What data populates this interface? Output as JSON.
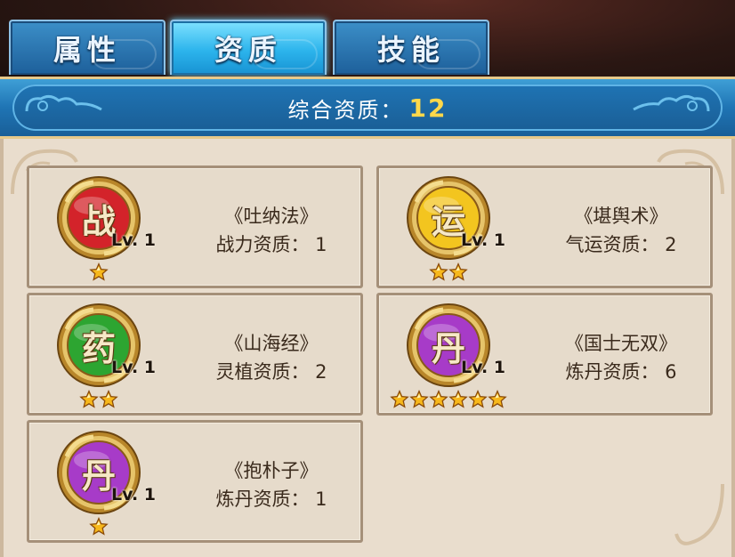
{
  "tabs": [
    {
      "label": "属性",
      "active": false
    },
    {
      "label": "资质",
      "active": true
    },
    {
      "label": "技能",
      "active": false
    }
  ],
  "header": {
    "label": "综合资质：",
    "value": "12"
  },
  "cards": [
    {
      "medal_char": "战",
      "medal_color": "#d3232a",
      "level": "Lv. 1",
      "stars": 1,
      "book": "《吐纳法》",
      "stat": "战力资质： 1"
    },
    {
      "medal_char": "运",
      "medal_color": "#f3c51f",
      "level": "Lv. 1",
      "stars": 2,
      "book": "《堪舆术》",
      "stat": "气运资质： 2"
    },
    {
      "medal_char": "药",
      "medal_color": "#2da531",
      "level": "Lv. 1",
      "stars": 2,
      "book": "《山海经》",
      "stat": "灵植资质： 2"
    },
    {
      "medal_char": "丹",
      "medal_color": "#a73bc8",
      "level": "Lv. 1",
      "stars": 6,
      "book": "《国士无双》",
      "stat": "炼丹资质： 6"
    },
    {
      "medal_char": "丹",
      "medal_color": "#a73bc8",
      "level": "Lv. 1",
      "stars": 1,
      "book": "《抱朴子》",
      "stat": "炼丹资质： 1"
    }
  ],
  "colors": {
    "tab_active": "#2cb4ec",
    "tab_inactive": "#1d5f9a",
    "value_gold": "#ffd84a",
    "star": "#f7b81b"
  },
  "icons": {
    "star": "star-icon",
    "cloud": "cloud-swirl-icon"
  }
}
